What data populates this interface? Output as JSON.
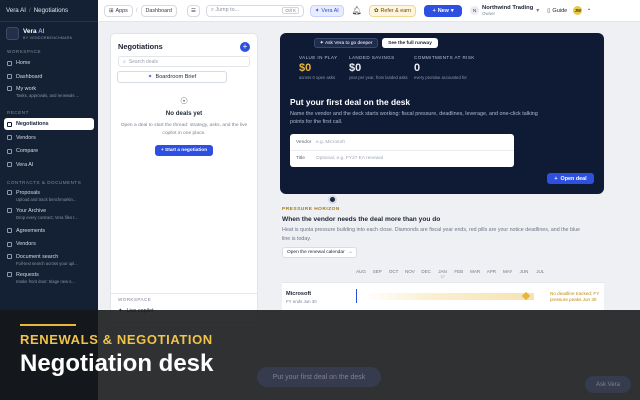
{
  "breadcrumb": {
    "root": "Vera AI",
    "current": "Negotiations"
  },
  "topbar": {
    "apps_label": "Apps",
    "dashboard_label": "Dashboard",
    "search_placeholder": "Jump to...",
    "search_shortcut": "Ctrl K",
    "vera_label": "Vera AI",
    "refer_label": "Refer & earn",
    "new_label": "New",
    "org_initial": "N",
    "org_name": "Northwind Trading",
    "org_role": "Owner",
    "guide_label": "Guide",
    "user_initials": "JW"
  },
  "sidebar": {
    "brand_name": "Vera",
    "brand_ai": "AI",
    "brand_by": "BY VENDORBENCHMARK",
    "workspace_label": "WORKSPACE",
    "home": "Home",
    "dashboard": "Dashboard",
    "mywork": "My work",
    "mywork_sub": "Tasks, approvals, and renewals ...",
    "recent_label": "RECENT",
    "negotiations": "Negotiations",
    "vendors": "Vendors",
    "compare": "Compare",
    "vera_ai": "Vera AI",
    "contracts_label": "CONTRACTS & DOCUMENTS",
    "proposals": "Proposals",
    "proposals_sub": "Upload and track benchmarkin...",
    "archive": "Your Archive",
    "archive_sub": "Drop every contract; Vera files t...",
    "agreements": "Agreements",
    "vendors2": "Vendors",
    "docsearch": "Document search",
    "docsearch_sub": "Full-text search across your upl...",
    "requests": "Requests",
    "requests_sub": "Intake front door: triage new s..."
  },
  "panel": {
    "title": "Negotiations",
    "search_placeholder": "Search deals",
    "brief_label": "Boardroom Brief",
    "empty_title": "No deals yet",
    "empty_desc": "Open a deal to start the thread: strategy, asks, and the live copilot in one place.",
    "start_label": "Start a negotiation",
    "workspace_label": "WORKSPACE",
    "live_label": "Live copilot"
  },
  "hero": {
    "ask_label": "Ask Vera to go deeper",
    "runway_label": "See the full runway",
    "stats": [
      {
        "label": "VALUE IN PLAY",
        "value": "$0",
        "sub": "across 0 open asks"
      },
      {
        "label": "LANDED SAVINGS",
        "value": "$0",
        "sub": "year per year, from landed asks"
      },
      {
        "label": "COMMITMENTS AT RISK",
        "value": "0",
        "sub": "every promise accounted for"
      }
    ],
    "title": "Put your first deal on the desk",
    "desc": "Name the vendor and the deck starts working: fiscal pressure, deadlines, leverage, and one-click talking points for the first call.",
    "vendor_label": "Vendor",
    "vendor_placeholder": "e.g. Microsoft",
    "title_label": "Title",
    "title_placeholder": "Optional, e.g. FY27 EA renewal",
    "open_label": "Open deal"
  },
  "horizon": {
    "kicker": "PRESSURE HORIZON",
    "heading": "When the vendor needs the deal more than you do",
    "desc": "Heat is quota pressure building into each close. Diamonds are fiscal year ends, red pills are your notice deadlines, and the blue line is today.",
    "calendar_label": "Open the renewal calendar",
    "months": [
      "AUG",
      "SEP",
      "OCT",
      "NOV",
      "DEC",
      "JAN",
      "FEB",
      "MAR",
      "APR",
      "MAY",
      "JUN",
      "JUL"
    ],
    "year_marker": "'27",
    "vendor_name": "Microsoft",
    "vendor_sub": "FY ends Jun 30",
    "warn_line1": "No deadline tracked; FY",
    "warn_line2": "pressure peaks Jun 30"
  },
  "overlay": {
    "kicker": "RENEWALS & NEGOTIATION",
    "title": "Negotiation desk",
    "ghost_button": "Put your first deal on the desk",
    "ghost_ask": "Ask Vera"
  }
}
